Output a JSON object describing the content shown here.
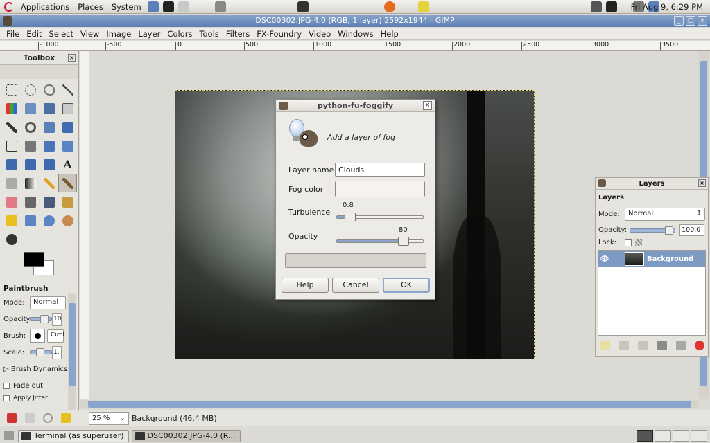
{
  "desktop_panel": {
    "menus": [
      "Applications",
      "Places",
      "System"
    ],
    "clock": "Fri Aug  9,  6:29 PM"
  },
  "window": {
    "title": "DSC00302.JPG-4.0 (RGB, 1 layer) 2592x1944 - GIMP"
  },
  "menubar": [
    "File",
    "Edit",
    "Select",
    "View",
    "Image",
    "Layer",
    "Colors",
    "Tools",
    "Filters",
    "FX-Foundry",
    "Video",
    "Windows",
    "Help"
  ],
  "ruler": {
    "labels": [
      "-1000",
      "-500",
      "0",
      "500",
      "1000",
      "1500",
      "2000",
      "2500",
      "3000",
      "3500"
    ]
  },
  "toolbox": {
    "title": "Toolbox",
    "options_title": "Paintbrush",
    "mode_label": "Mode:",
    "mode_value": "Normal",
    "opacity_label": "Opacity:",
    "opacity_value": "10",
    "brush_label": "Brush:",
    "brush_value": "Circl",
    "scale_label": "Scale:",
    "scale_value": "1.",
    "brush_dynamics": "Brush Dynamics",
    "fade_out": "Fade out",
    "apply_jitter": "Apply Jitter"
  },
  "status": {
    "zoom": "25 %",
    "text": "Background (46.4 MB)"
  },
  "taskbar": {
    "items": [
      "Terminal (as superuser)",
      "DSC00302.JPG-4.0 (R..."
    ]
  },
  "dialog": {
    "title": "python-fu-foggify",
    "subtitle": "Add a layer of fog",
    "layer_name_label": "Layer name",
    "layer_name_value": "Clouds",
    "fog_color_label": "Fog color",
    "fog_color": "#f6f3ee",
    "turbulence_label": "Turbulence",
    "turbulence_value": "0.8",
    "turbulence_fraction": 0.1,
    "opacity_label": "Opacity",
    "opacity_value": "80",
    "opacity_fraction": 0.8,
    "help": "Help",
    "cancel": "Cancel",
    "ok": "OK"
  },
  "layers": {
    "dock_title": "Layers",
    "panel_title": "Layers",
    "mode_label": "Mode:",
    "mode_value": "Normal",
    "opacity_label": "Opacity:",
    "opacity_value": "100.0",
    "lock_label": "Lock:",
    "layer_name": "Background"
  },
  "colors": {
    "accent": "#7d9ac3",
    "titlebar": "#6f8fbf"
  }
}
